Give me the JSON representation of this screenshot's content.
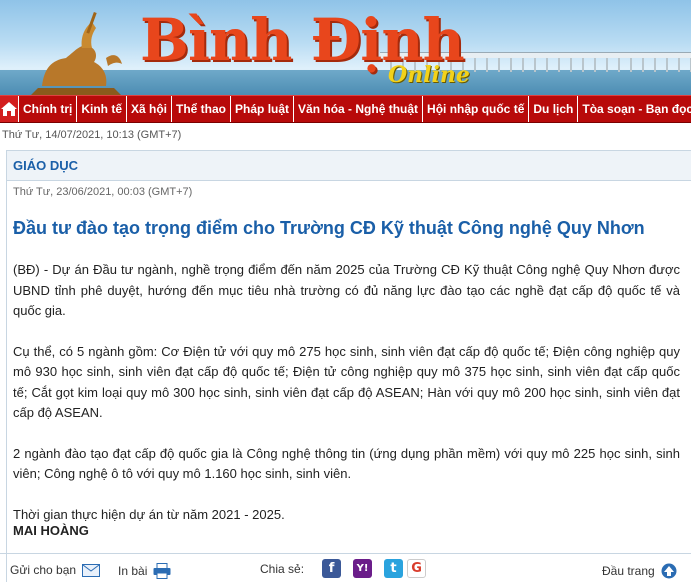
{
  "site": {
    "logo_text": "Bình Định",
    "logo_suffix": "Online"
  },
  "nav": {
    "home_icon": "home-icon",
    "items": [
      {
        "label": "Chính trị"
      },
      {
        "label": "Kinh tế"
      },
      {
        "label": "Xã hội"
      },
      {
        "label": "Thể thao"
      },
      {
        "label": "Pháp luật"
      },
      {
        "label": "Văn hóa - Nghệ thuật"
      },
      {
        "label": "Hội nhập quốc tế"
      },
      {
        "label": "Du lịch"
      },
      {
        "label": "Tòa soạn - Bạn đọc"
      }
    ]
  },
  "current_date": "Thứ Tư, 14/07/2021, 10:13 (GMT+7)",
  "article": {
    "section": "GIÁO DỤC",
    "published": "Thứ Tư, 23/06/2021, 00:03 (GMT+7)",
    "title": "Đầu tư đào tạo trọng điểm cho Trường CĐ Kỹ thuật Công nghệ Quy Nhơn",
    "paragraphs": [
      "(BĐ) - Dự án Đầu tư ngành, nghề trọng điểm đến năm 2025 của Trường CĐ Kỹ thuật Công nghệ Quy Nhơn được UBND tỉnh phê duyệt, hướng đến mục tiêu nhà trường có đủ năng lực đào tạo các nghề đạt cấp độ quốc tế và quốc gia.",
      "Cụ thể, có 5 ngành gồm: Cơ Điện tử với quy mô 275 học sinh, sinh viên đạt cấp độ quốc tế; Điện công nghiệp quy mô 930 học sinh, sinh viên đạt cấp độ quốc tế; Điện tử công nghiệp quy mô 375 học sinh, sinh viên đạt cấp quốc tế; Cắt gọt kim loại quy mô 300 học sinh, sinh viên đạt cấp độ ASEAN; Hàn với quy mô 200 học sinh, sinh viên đạt cấp độ ASEAN.",
      "2 ngành đào tạo đạt cấp độ quốc gia là Công nghệ thông tin (ứng dụng phần mềm) với quy mô 225 học sinh, sinh viên; Công nghệ ô tô với quy mô 1.160 học sinh, sinh viên.",
      "Thời gian thực hiện dự án từ năm 2021 - 2025."
    ],
    "author": "MAI HOÀNG"
  },
  "tools": {
    "send_label": "Gửi cho bạn",
    "send_icon": "envelope-icon",
    "print_label": "In bài",
    "print_icon": "printer-icon",
    "share_label": "Chia sẻ:",
    "share_icons": {
      "facebook": "f",
      "yahoo": "Y!",
      "twitter": "t",
      "google": "G"
    },
    "top_label": "Đầu trang",
    "top_icon": "arrow-up-icon"
  },
  "colors": {
    "nav_bg": "#b80a0a",
    "accent_blue": "#1a5fa8",
    "logo_red": "#e8461c",
    "logo_yellow": "#f3d21a"
  }
}
